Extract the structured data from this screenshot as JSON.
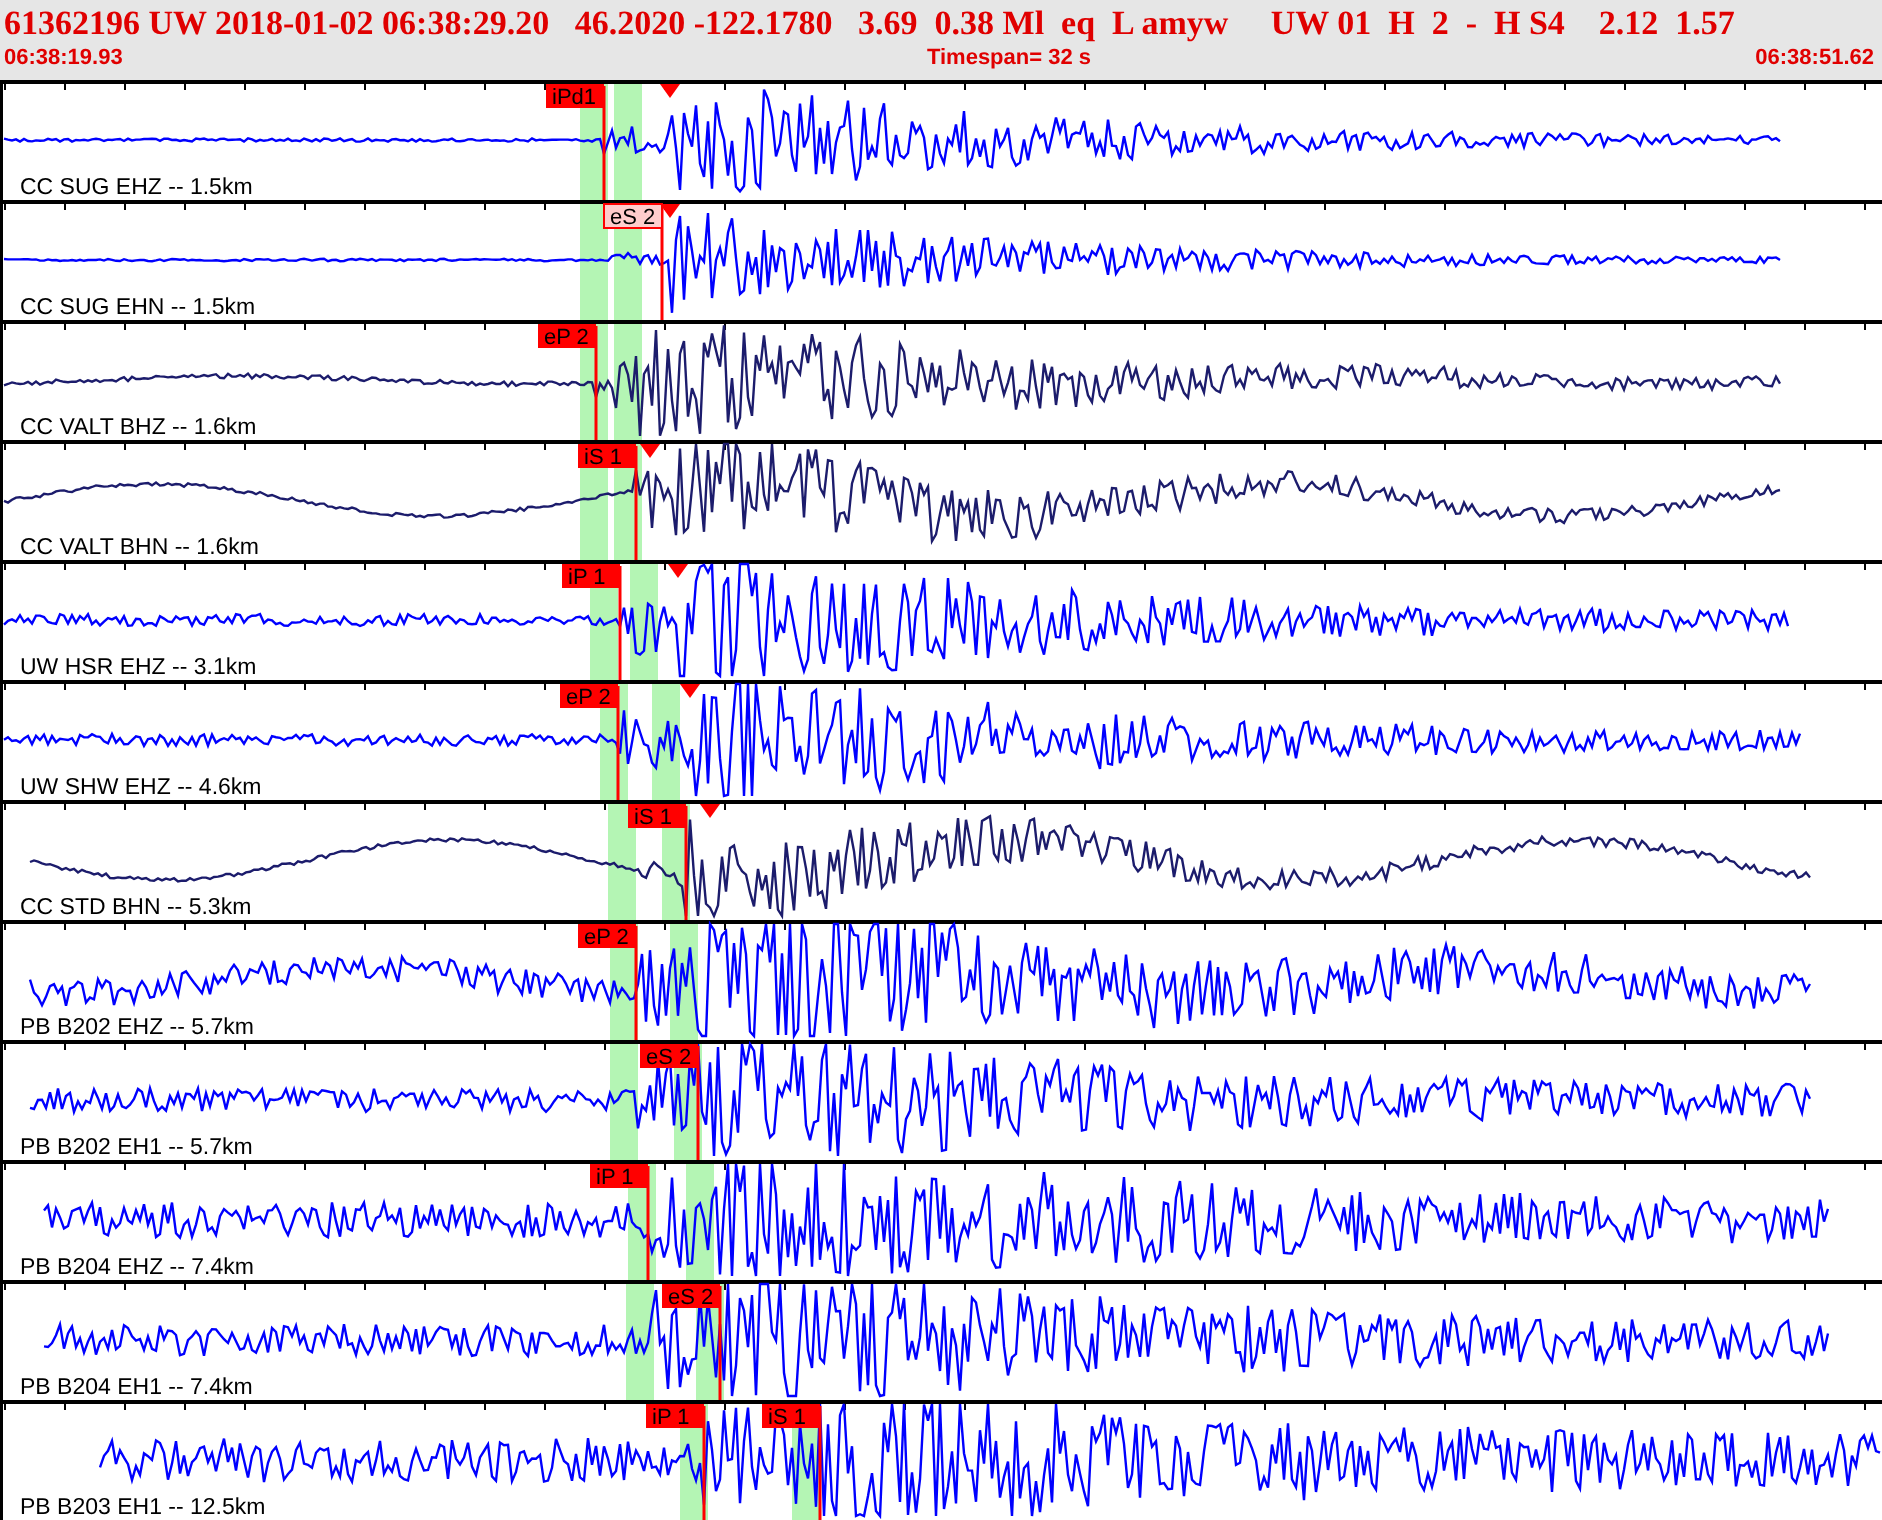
{
  "header": {
    "event_line": "61362196 UW 2018-01-02 06:38:29.20   46.2020 -122.1780   3.69  0.38 Ml  eq  L amyw     UW 01  H  2  -  H S4    2.12  1.57",
    "start_time": "06:38:19.93",
    "timespan": "Timespan=  32 s",
    "end_time": "06:38:51.62"
  },
  "traces": [
    {
      "label": "CC SUG EHZ -- 1.5km",
      "color": "#0000ff",
      "picks": [
        {
          "label": "iPd1",
          "selected": false
        }
      ]
    },
    {
      "label": "CC SUG EHN -- 1.5km",
      "color": "#0000ff",
      "picks": [
        {
          "label": "eS 2",
          "selected": true
        }
      ]
    },
    {
      "label": "CC VALT BHZ -- 1.6km",
      "color": "#1c1c6c",
      "picks": [
        {
          "label": "eP 2",
          "selected": false
        }
      ]
    },
    {
      "label": "CC VALT BHN -- 1.6km",
      "color": "#1c1c6c",
      "picks": [
        {
          "label": "iS 1",
          "selected": false
        }
      ]
    },
    {
      "label": "UW HSR EHZ -- 3.1km",
      "color": "#0000ff",
      "picks": [
        {
          "label": "iP 1",
          "selected": false
        }
      ]
    },
    {
      "label": "UW SHW EHZ -- 4.6km",
      "color": "#0000ff",
      "picks": [
        {
          "label": "eP 2",
          "selected": false
        }
      ]
    },
    {
      "label": "CC STD BHN -- 5.3km",
      "color": "#1c1c6c",
      "picks": [
        {
          "label": "iS 1",
          "selected": false
        }
      ]
    },
    {
      "label": "PB B202 EHZ -- 5.7km",
      "color": "#0000ff",
      "picks": [
        {
          "label": "eP 2",
          "selected": false
        }
      ]
    },
    {
      "label": "PB B202 EH1 -- 5.7km",
      "color": "#0000ff",
      "picks": [
        {
          "label": "eS 2",
          "selected": false
        }
      ]
    },
    {
      "label": "PB B204 EHZ -- 7.4km",
      "color": "#0000ff",
      "picks": [
        {
          "label": "iP 1",
          "selected": false
        }
      ]
    },
    {
      "label": "PB B204 EH1 -- 7.4km",
      "color": "#0000ff",
      "picks": [
        {
          "label": "eS 2",
          "selected": false
        }
      ]
    },
    {
      "label": "PB B203 EH1 -- 12.5km",
      "color": "#0000ff",
      "picks": [
        {
          "label": "iP 1",
          "selected": false
        },
        {
          "label": "iS 1",
          "selected": false
        }
      ]
    }
  ]
}
